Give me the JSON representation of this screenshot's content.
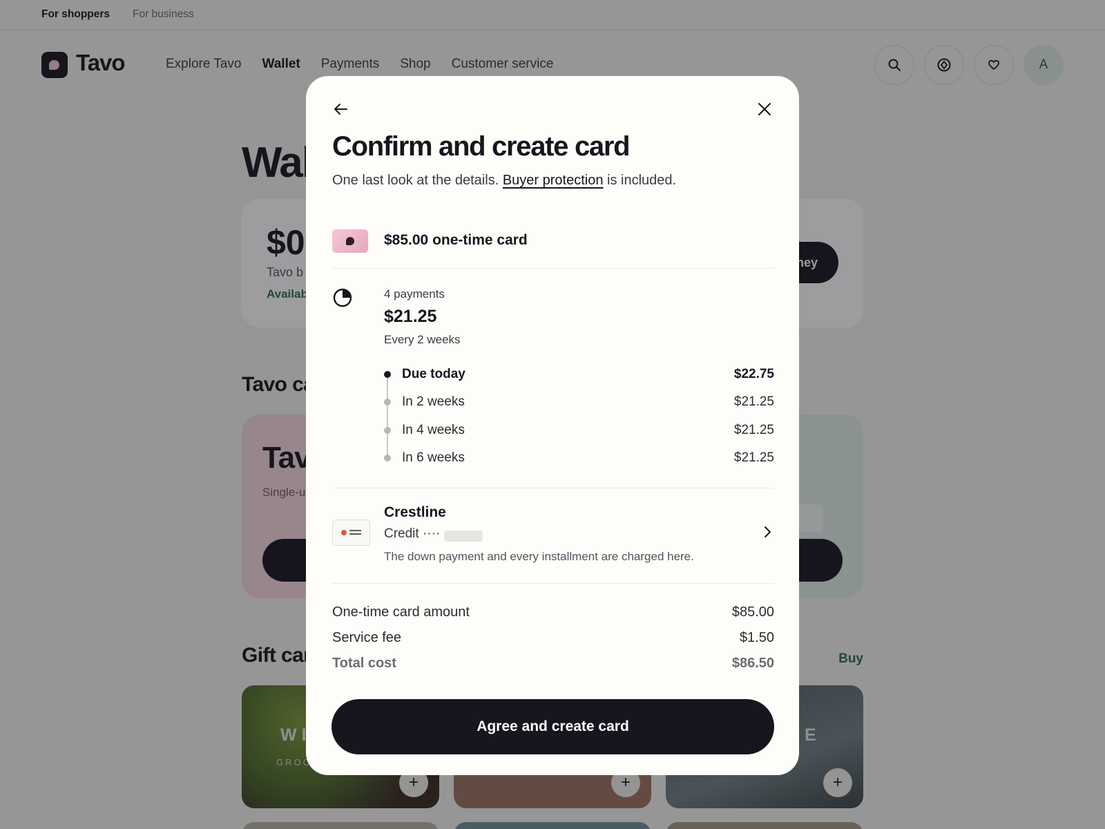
{
  "top_strip": {
    "shoppers": "For shoppers",
    "business": "For business"
  },
  "brand": {
    "name": "Tavo"
  },
  "nav": [
    "Explore Tavo",
    "Wallet",
    "Payments",
    "Shop",
    "Customer service"
  ],
  "nav_active": "Wallet",
  "header_icons": [
    "search-icon",
    "location-target-icon",
    "heart-icon"
  ],
  "avatar": {
    "initial": "A"
  },
  "background": {
    "page_title": "Wal",
    "balance_amount": "$0",
    "balance_label": "Tavo b",
    "available": "Availab",
    "add_money": "ney",
    "cards_section": "Tavo ca",
    "pink_card_title": "Tav",
    "pink_card_sub": "Single-u store",
    "gift_section": "Gift car",
    "buy": "Buy",
    "gift_tiles": [
      {
        "title": "WI",
        "sub": "GROC"
      },
      {
        "title": "",
        "sub": ""
      },
      {
        "title": "NE",
        "sub": ""
      }
    ]
  },
  "modal": {
    "title": "Confirm and create card",
    "subtitle_prefix": "One last look at the details.",
    "subtitle_link": "Buyer protection",
    "subtitle_suffix": "is included.",
    "card": {
      "name": "$85.00 one-time card"
    },
    "plan": {
      "count": "4 payments",
      "amount": "$21.25",
      "frequency": "Every 2 weeks",
      "schedule": [
        {
          "label": "Due today",
          "value": "$22.75"
        },
        {
          "label": "In 2 weeks",
          "value": "$21.25"
        },
        {
          "label": "In 4 weeks",
          "value": "$21.25"
        },
        {
          "label": "In 6 weeks",
          "value": "$21.25"
        }
      ]
    },
    "payment_method": {
      "bank": "Crestline",
      "account": "Credit ····",
      "note": "The down payment and every installment are charged here."
    },
    "summary": [
      {
        "label": "One-time card amount",
        "value": "$85.00"
      },
      {
        "label": "Service fee",
        "value": "$1.50"
      },
      {
        "label": "Total cost",
        "value": "$86.50"
      }
    ],
    "cta": "Agree and create card"
  },
  "colors": {
    "accent_dark": "#17161f",
    "link_green": "#2e6b4e",
    "pink": "#f7d7e1",
    "mint": "#dfeee6"
  }
}
